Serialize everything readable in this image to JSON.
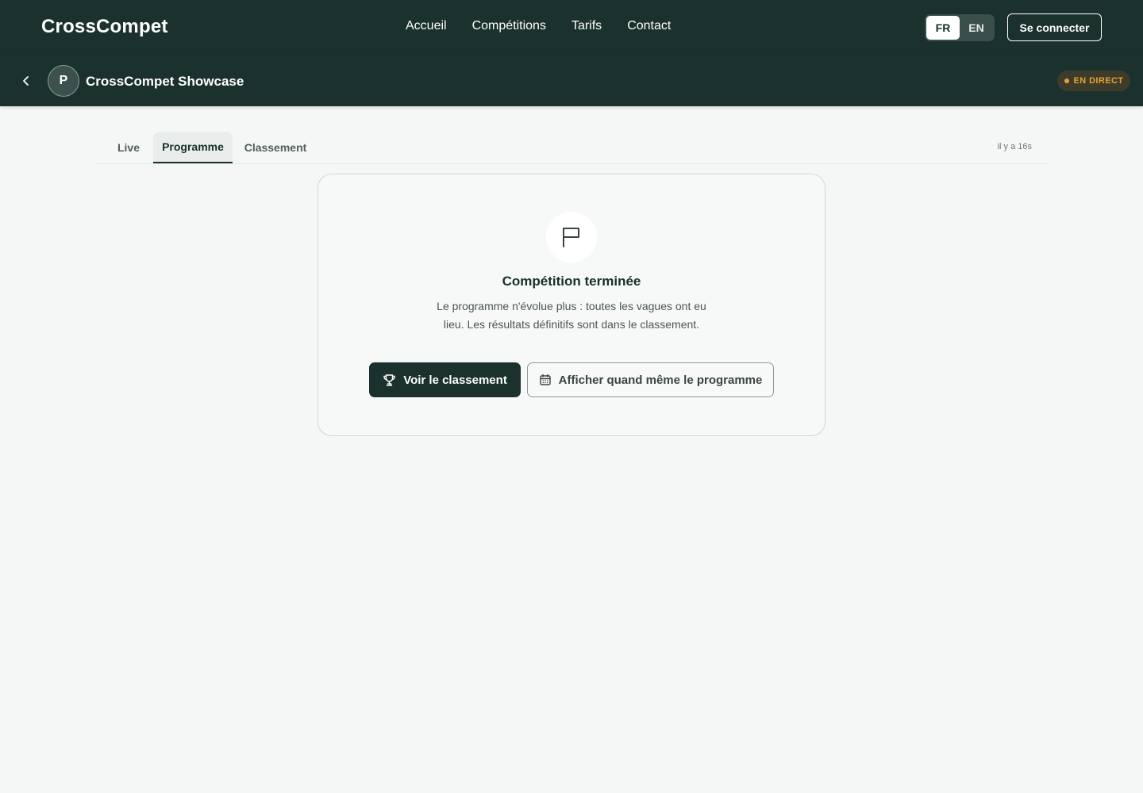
{
  "nav": {
    "brand": "CrossCompet",
    "links": [
      "Accueil",
      "Compétitions",
      "Tarifs",
      "Contact"
    ],
    "lang": {
      "fr": "FR",
      "en": "EN",
      "active": "FR"
    },
    "login": "Se connecter"
  },
  "subheader": {
    "avatar_letter": "P",
    "title": "CrossCompet Showcase",
    "live_badge": "EN DIRECT",
    "back_icon": "chevron-left-icon"
  },
  "tabs": {
    "items": [
      "Live",
      "Programme",
      "Classement"
    ],
    "active": "Programme",
    "updated": "il y a 16s"
  },
  "card": {
    "icon": "flag-icon",
    "title": "Compétition terminée",
    "text": "Le programme n'évolue plus : toutes les vagues ont eu lieu. Les résultats définitifs sont dans le classement.",
    "primary_button": "Voir le classement",
    "primary_icon": "trophy-icon",
    "secondary_button": "Afficher quand même le programme",
    "secondary_icon": "calendar-icon"
  },
  "colors": {
    "header_bg": "#1a312d",
    "page_bg": "#f5f7f6",
    "live_accent": "#e8a13a"
  }
}
